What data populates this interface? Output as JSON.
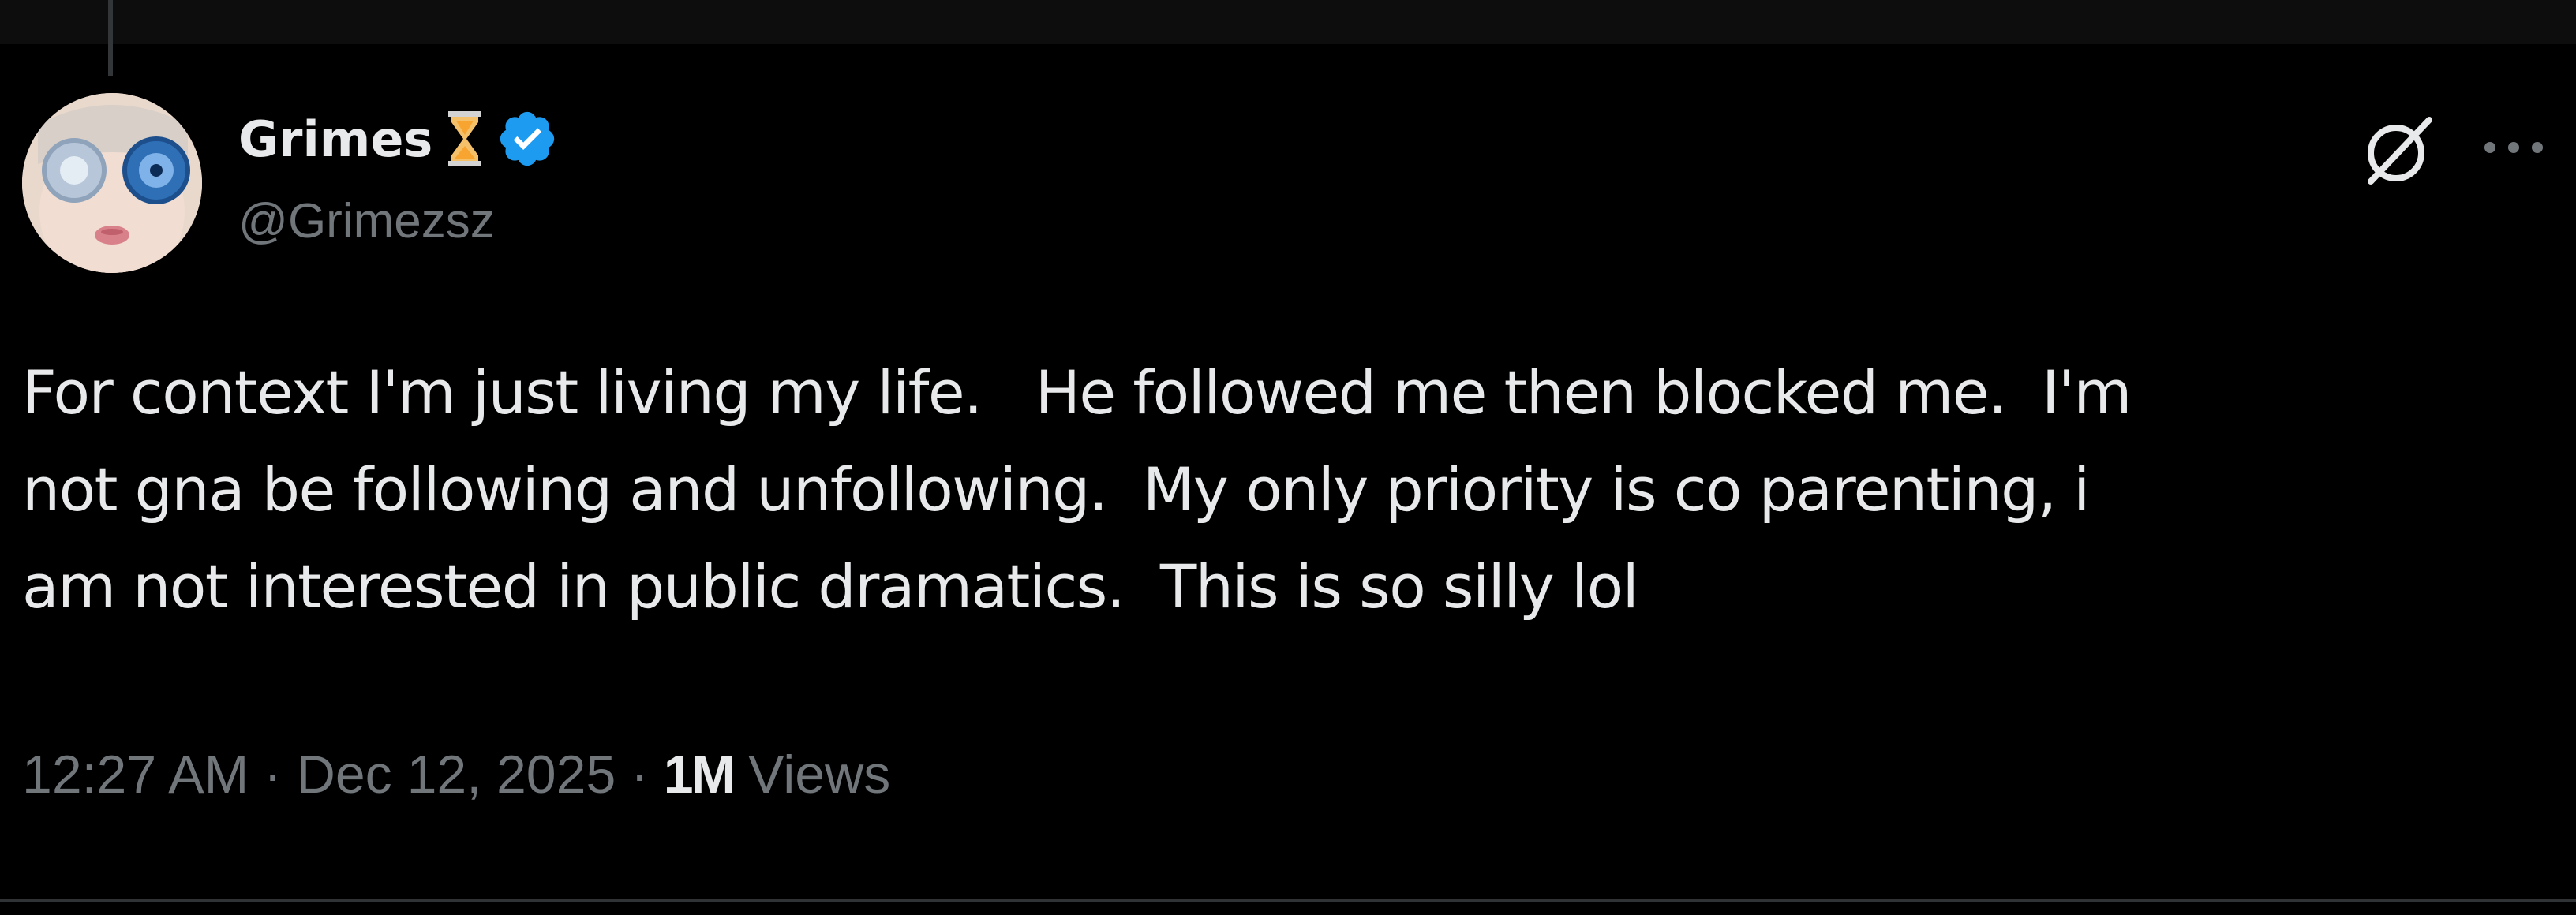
{
  "tweet": {
    "author": {
      "display_name": "Grimes",
      "name_emoji": "hourglass-icon",
      "verified_badge": "verified-badge-icon",
      "handle": "@Grimezsz"
    },
    "text": "For context I'm just living my life.   He followed me then blocked me.  I'm\nnot gna be following and unfollowing.  My only priority is co parenting, i\nam not interested in public dramatics.  This is so silly lol",
    "meta": {
      "time": "12:27 AM",
      "separator": " · ",
      "date": "Dec 12, 2025",
      "views_count": "1M",
      "views_label": " Views"
    },
    "actions": {
      "grok_icon": "grok-icon",
      "more_icon": "more-icon"
    }
  },
  "colors": {
    "background": "#000000",
    "primary_text": "#e7e9ea",
    "secondary_text": "#71767b",
    "verified_blue": "#1d9bf0",
    "divider": "#2f3336"
  }
}
